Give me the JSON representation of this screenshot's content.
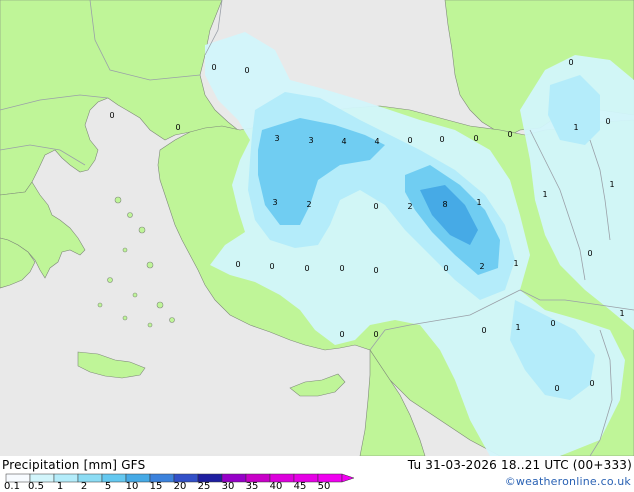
{
  "header": {
    "product_label": "Precipitation [mm]",
    "model": "GFS",
    "valid_time": "Tu 31-03-2026 18..21 UTC (00+333)",
    "credit": "©weatheronline.co.uk"
  },
  "legend": {
    "ticks": [
      "0.1",
      "0.5",
      "1",
      "2",
      "5",
      "10",
      "15",
      "20",
      "25",
      "30",
      "35",
      "40",
      "45",
      "50"
    ],
    "colors": [
      "#f7fbff",
      "#d2f5fb",
      "#b4ecfa",
      "#8cdcf4",
      "#64c8f0",
      "#46aae6",
      "#3c82dc",
      "#3250c8",
      "#1e1ea0",
      "#9600c8",
      "#c800c8",
      "#dc00dc",
      "#e600e6",
      "#f000f0"
    ]
  },
  "colors": {
    "land": "#bff598",
    "sea": "#e9e9e9",
    "precip_light": "#d2f5fb",
    "precip_mid": "#b4ecfa",
    "precip_heavy": "#64c8f0",
    "precip_core": "#46aae6",
    "border": "#9aa0a8"
  },
  "map_labels": [
    {
      "text": "0",
      "name": "value-label"
    },
    {
      "text": "0",
      "name": "value-label"
    },
    {
      "text": "0",
      "name": "value-label"
    },
    {
      "text": "0",
      "name": "value-label"
    },
    {
      "text": "3",
      "name": "value-label"
    },
    {
      "text": "3",
      "name": "value-label"
    },
    {
      "text": "4",
      "name": "value-label"
    },
    {
      "text": "4",
      "name": "value-label"
    },
    {
      "text": "0",
      "name": "value-label"
    },
    {
      "text": "0",
      "name": "value-label"
    },
    {
      "text": "0",
      "name": "value-label"
    },
    {
      "text": "0",
      "name": "value-label"
    },
    {
      "text": "0",
      "name": "value-label"
    },
    {
      "text": "1",
      "name": "value-label"
    },
    {
      "text": "0",
      "name": "value-label"
    },
    {
      "text": "3",
      "name": "value-label"
    },
    {
      "text": "2",
      "name": "value-label"
    },
    {
      "text": "0",
      "name": "value-label"
    },
    {
      "text": "2",
      "name": "value-label"
    },
    {
      "text": "8",
      "name": "value-label"
    },
    {
      "text": "1",
      "name": "value-label"
    },
    {
      "text": "1",
      "name": "value-label"
    },
    {
      "text": "1",
      "name": "value-label"
    },
    {
      "text": "0",
      "name": "value-label"
    },
    {
      "text": "0",
      "name": "value-label"
    },
    {
      "text": "0",
      "name": "value-label"
    },
    {
      "text": "0",
      "name": "value-label"
    },
    {
      "text": "0",
      "name": "value-label"
    },
    {
      "text": "0",
      "name": "value-label"
    },
    {
      "text": "0",
      "name": "value-label"
    },
    {
      "text": "2",
      "name": "value-label"
    },
    {
      "text": "1",
      "name": "value-label"
    },
    {
      "text": "0",
      "name": "value-label"
    },
    {
      "text": "0",
      "name": "value-label"
    },
    {
      "text": "0",
      "name": "value-label"
    },
    {
      "text": "1",
      "name": "value-label"
    },
    {
      "text": "0",
      "name": "value-label"
    },
    {
      "text": "1",
      "name": "value-label"
    },
    {
      "text": "0",
      "name": "value-label"
    },
    {
      "text": "0",
      "name": "value-label"
    }
  ]
}
